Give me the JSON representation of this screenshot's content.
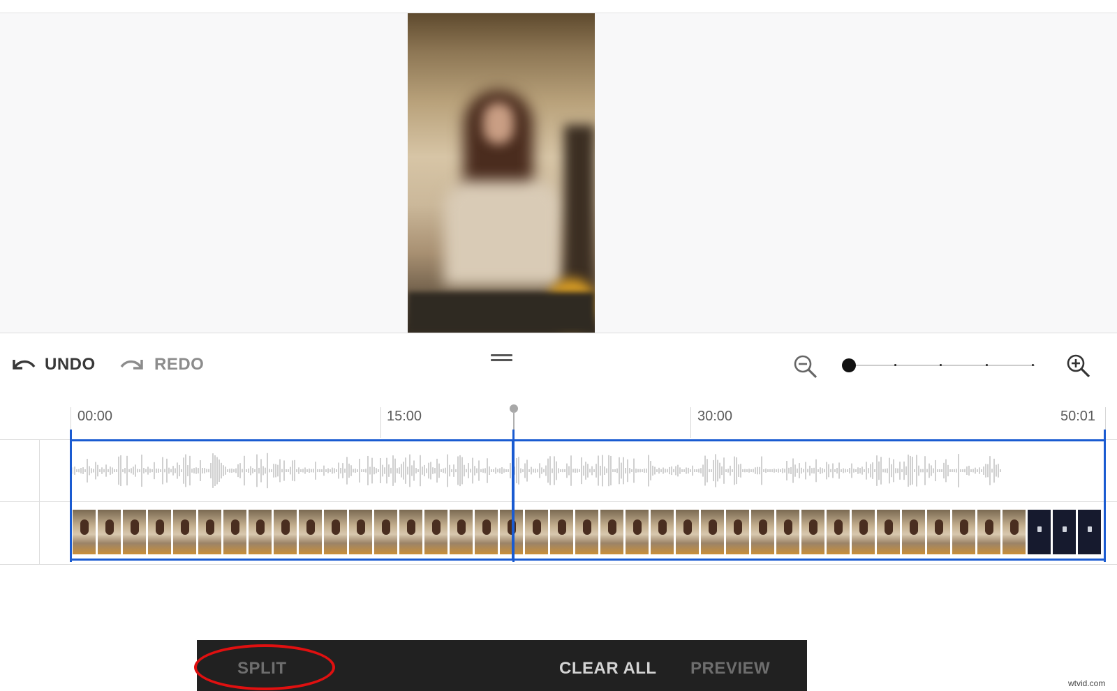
{
  "toolbar": {
    "undo_label": "UNDO",
    "redo_label": "REDO",
    "undo_icon": "undo-arrow-icon",
    "redo_icon": "redo-arrow-icon",
    "zoom_out_icon": "zoom-out-icon",
    "zoom_in_icon": "zoom-in-icon",
    "zoom_level": "1 of 5"
  },
  "timeline": {
    "tick_labels": [
      "00:00",
      "15:00",
      "30:00",
      "50:01"
    ],
    "playhead_time_fraction": 0.43
  },
  "actions": {
    "split_label": "SPLIT",
    "clear_all_label": "CLEAR ALL",
    "preview_label": "PREVIEW"
  },
  "watermark": "wtvid.com",
  "colors": {
    "selection": "#1a5bd1",
    "highlight_circle": "#e01010",
    "action_bar": "#212121"
  }
}
